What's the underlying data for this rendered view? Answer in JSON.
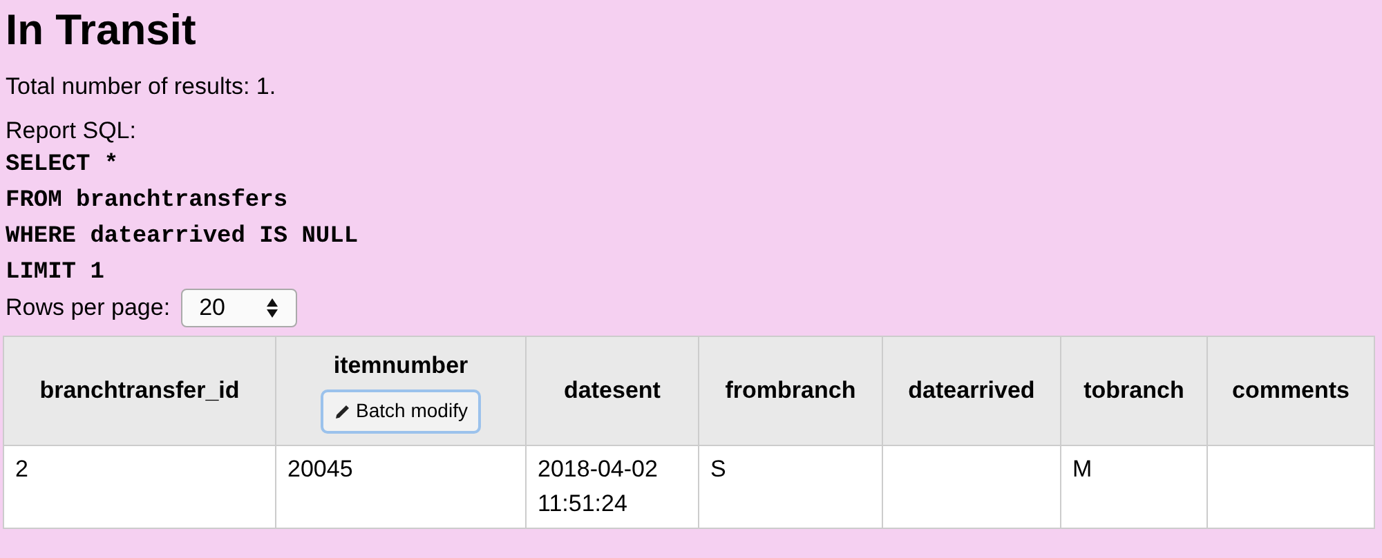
{
  "title": "In Transit",
  "total_results": "Total number of results: 1.",
  "report_sql": {
    "label": "Report SQL:",
    "lines": [
      "SELECT *",
      "FROM branchtransfers",
      "WHERE datearrived IS NULL",
      "LIMIT 1"
    ]
  },
  "rows_per_page": {
    "label": "Rows per page:",
    "value": "20"
  },
  "table": {
    "columns": [
      {
        "label": "branchtransfer_id"
      },
      {
        "label": "itemnumber",
        "button": "Batch modify"
      },
      {
        "label": "datesent"
      },
      {
        "label": "frombranch"
      },
      {
        "label": "datearrived"
      },
      {
        "label": "tobranch"
      },
      {
        "label": "comments"
      }
    ],
    "rows": [
      [
        "2",
        "20045",
        "2018-04-02 11:51:24",
        "S",
        "",
        "M",
        ""
      ]
    ]
  }
}
